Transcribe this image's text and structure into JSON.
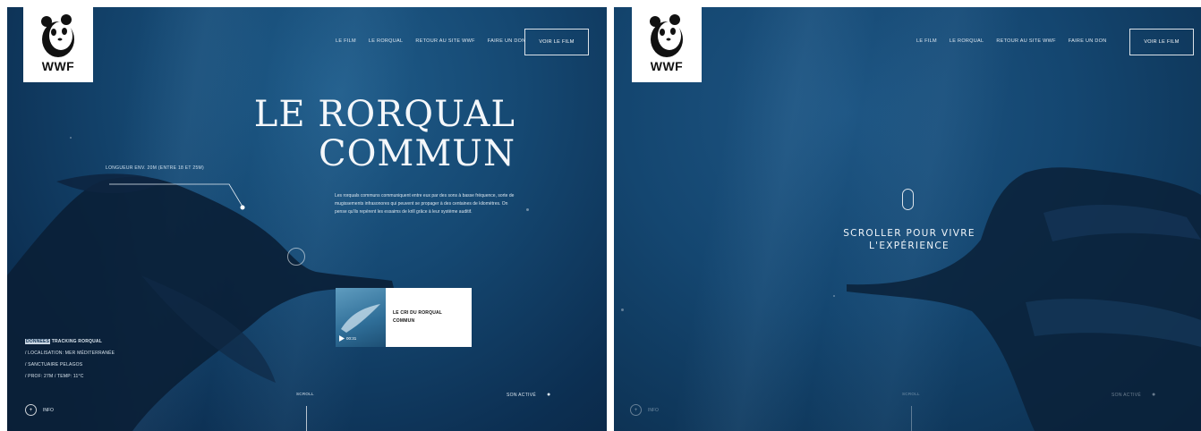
{
  "left": {
    "logo_text": "WWF",
    "nav": [
      "LE FILM",
      "LE RORQUAL",
      "RETOUR AU SITE WWF",
      "FAIRE UN DON"
    ],
    "cta_label": "VOIR LE FILM",
    "title_line1": "LE RORQUAL",
    "title_line2": "COMMUN",
    "length_label": "LONGUEUR ENV. 20M (ENTRE 18 ET 25M)",
    "paragraph": "Les rorquals communs communiquent entre eux par des sons à basse fréquence, sorte de mugissements infrasonores qui peuvent se propager à des centaines de kilomètres. On pense qu'ils repèrent les essaims de krill grâce à leur système auditif.",
    "card": {
      "title": "LE CRI DU RORQUAL COMMUN",
      "time": "00:31"
    },
    "data": {
      "tag": "DONNÉES",
      "first": "TRACKING RORQUAL",
      "items": [
        "/ LOCALISATION: MER MÉDITERRANÉE",
        "/ SANCTUAIRE PELAGOS",
        "/ PROF: 27M / TEMP: 11°C"
      ]
    },
    "info_label": "INFO",
    "scroll_label": "SCROLL",
    "sound_label": "SON ACTIVÉ"
  },
  "right": {
    "logo_text": "WWF",
    "nav": [
      "LE FILM",
      "LE RORQUAL",
      "RETOUR AU SITE WWF",
      "FAIRE UN DON"
    ],
    "cta_label": "VOIR LE FILM",
    "message_line1": "SCROLLER POUR VIVRE",
    "message_line2": "L'EXPÉRIENCE",
    "info_label": "INFO",
    "scroll_label": "SCROLL",
    "sound_label": "SON ACTIVÉ"
  },
  "colors": {
    "ocean_deep": "#0c2f52",
    "ocean_mid": "#154872",
    "whale": "#0a1f36",
    "text": "#dbe6ef"
  }
}
